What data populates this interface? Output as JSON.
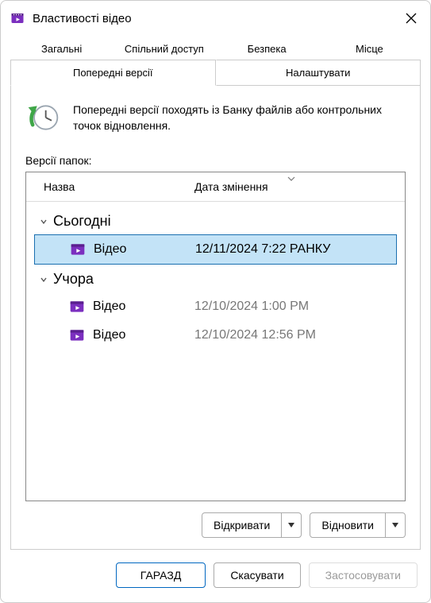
{
  "window": {
    "title": "Властивості відео"
  },
  "tabs": {
    "row1": [
      "Загальні",
      "Спільний доступ",
      "Безпека",
      "Місце"
    ],
    "row2": [
      "Попередні версії",
      "Налаштувати"
    ],
    "active": "Попередні версії"
  },
  "info": {
    "text": "Попередні версії походять із Банку файлів або контрольних точок відновлення."
  },
  "versions": {
    "label": "Версії папок:",
    "columns": {
      "name": "Назва",
      "date": "Дата змінення"
    },
    "groups": [
      {
        "label": "Сьогодні",
        "items": [
          {
            "name": "Відео",
            "date": "12/11/2024 7:22 РАНКУ",
            "selected": true
          }
        ]
      },
      {
        "label": "Учора",
        "items": [
          {
            "name": "Відео",
            "date": "12/10/2024 1:00 PM",
            "selected": false
          },
          {
            "name": "Відео",
            "date": "12/10/2024 12:56 PM",
            "selected": false
          }
        ]
      }
    ]
  },
  "actions": {
    "open": "Відкривати",
    "restore": "Відновити"
  },
  "footer": {
    "ok": "ГАРАЗД",
    "cancel": "Скасувати",
    "apply": "Застосовувати"
  },
  "icons": {
    "app": "video-folder-icon",
    "close": "close-icon",
    "history": "history-restore-icon",
    "file": "video-file-icon"
  }
}
